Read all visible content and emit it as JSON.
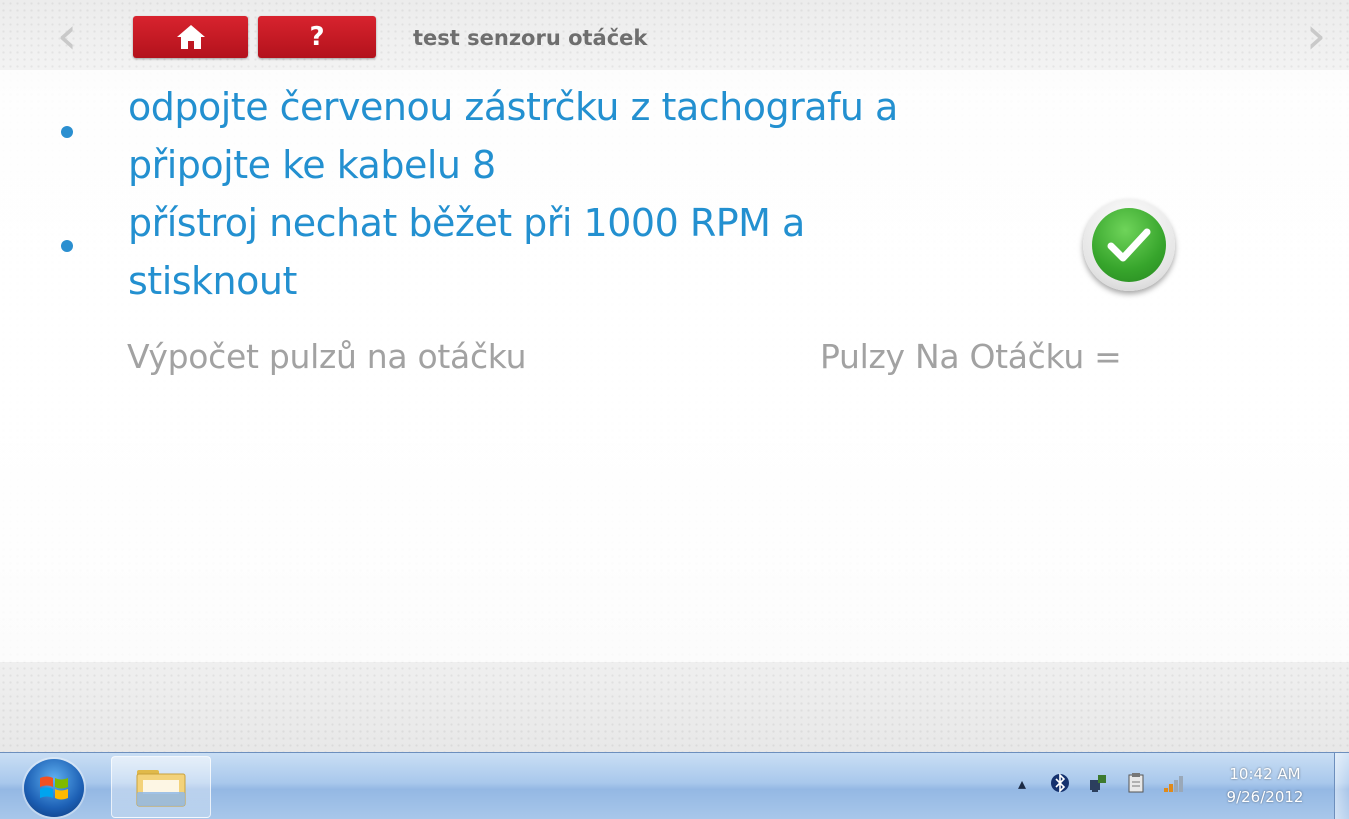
{
  "header": {
    "title": "test senzoru otáček",
    "help_label": "?"
  },
  "instructions": [
    {
      "text": "odpojte červenou zástrčku z tachografu a\npřipojte ke kabelu 8"
    },
    {
      "text": "přístroj nechat běžet při 1000 RPM a\nstisknout"
    }
  ],
  "results": {
    "calc_label": "Výpočet pulzů na otáčku",
    "pulses_label": "Pulzy Na Otáčku ="
  },
  "icons": {
    "back": "chevron-left-icon",
    "forward": "chevron-right-icon",
    "home": "home-icon",
    "ok": "checkmark-icon"
  },
  "colors": {
    "accent_red": "#c8161f",
    "instruction_blue": "#2390d0",
    "ok_green": "#37a52c",
    "muted_text": "#a2a2a2"
  },
  "taskbar": {
    "time": "10:42 AM",
    "date": "9/26/2012",
    "tray_icons": [
      "show-hidden-icon",
      "bluetooth-icon",
      "network-device-icon",
      "clipboard-icon",
      "signal-icon"
    ]
  }
}
